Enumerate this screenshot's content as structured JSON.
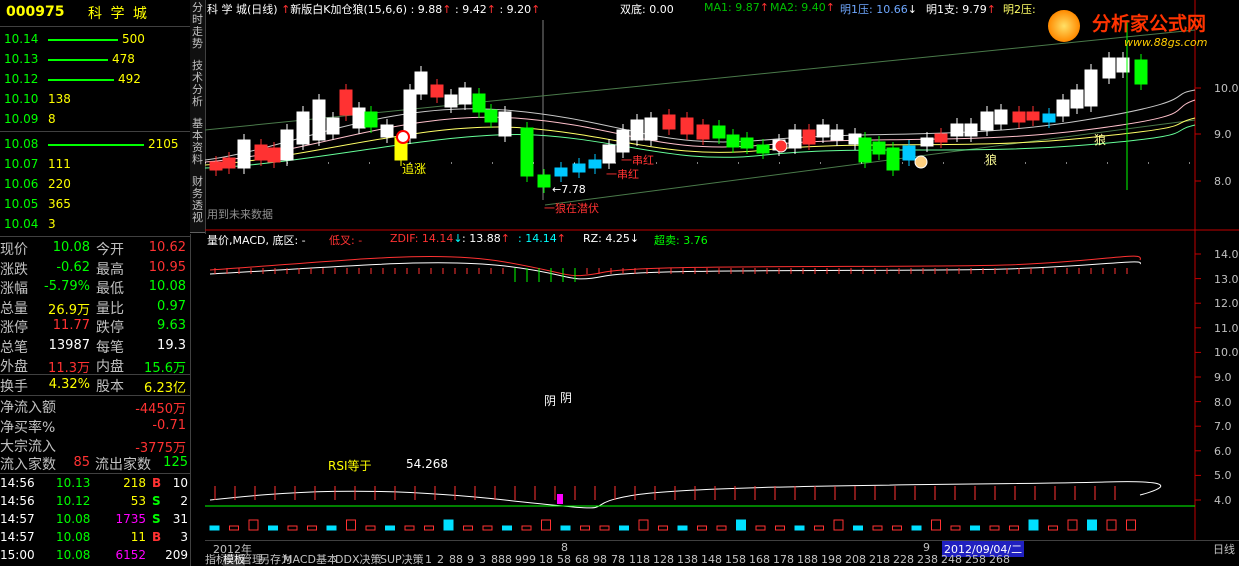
{
  "stock": {
    "code": "000975",
    "name": "科 学 城"
  },
  "asks": [
    {
      "price": "10.14",
      "vol": "500",
      "bar": 70
    },
    {
      "price": "10.13",
      "vol": "478",
      "bar": 60
    },
    {
      "price": "10.12",
      "vol": "492",
      "bar": 66
    },
    {
      "price": "10.10",
      "vol": "138",
      "bar": 0
    },
    {
      "price": "10.09",
      "vol": "8",
      "bar": 0
    }
  ],
  "bids": [
    {
      "price": "10.08",
      "vol": "2105",
      "bar": 96
    },
    {
      "price": "10.07",
      "vol": "111",
      "bar": 0
    },
    {
      "price": "10.06",
      "vol": "220",
      "bar": 0
    },
    {
      "price": "10.05",
      "vol": "365",
      "bar": 0
    },
    {
      "price": "10.04",
      "vol": "3",
      "bar": 0
    }
  ],
  "stats": [
    {
      "k1": "现价",
      "v1": "10.08",
      "c1": "grn",
      "k2": "今开",
      "v2": "10.62",
      "c2": "red"
    },
    {
      "k1": "涨跌",
      "v1": "-0.62",
      "c1": "grn",
      "k2": "最高",
      "v2": "10.95",
      "c2": "red"
    },
    {
      "k1": "涨幅",
      "v1": "-5.79%",
      "c1": "grn",
      "k2": "最低",
      "v2": "10.08",
      "c2": "grn"
    },
    {
      "k1": "总量",
      "v1": "26.9万",
      "c1": "yel",
      "k2": "量比",
      "v2": "0.97",
      "c2": "grn"
    },
    {
      "k1": "涨停",
      "v1": "11.77",
      "c1": "red",
      "k2": "跌停",
      "v2": "9.63",
      "c2": "grn"
    },
    {
      "k1": "总笔",
      "v1": "13987",
      "c1": "wht",
      "k2": "每笔",
      "v2": "19.3",
      "c2": "wht"
    },
    {
      "k1": "外盘",
      "v1": "11.3万",
      "c1": "red",
      "k2": "内盘",
      "v2": "15.6万",
      "c2": "grn"
    }
  ],
  "turnover": {
    "k1": "换手",
    "v1": "4.32%",
    "k2": "股本",
    "v2": "6.23亿"
  },
  "flows": [
    {
      "k": "净流入额",
      "v": "-4450万"
    },
    {
      "k": "净买率%",
      "v": "-0.71"
    },
    {
      "k": "大宗流入",
      "v": "-3775万"
    }
  ],
  "flowcount": {
    "k1": "流入家数",
    "v1": "85",
    "k2": "流出家数",
    "v2": "125"
  },
  "ticks": [
    {
      "t": "14:56",
      "p": "10.13",
      "pc": "grn",
      "v": "218",
      "vc": "yel",
      "s": "B",
      "sc": "red",
      "n": "10"
    },
    {
      "t": "14:56",
      "p": "10.12",
      "pc": "grn",
      "v": "53",
      "vc": "yel",
      "s": "S",
      "sc": "grn",
      "n": "2"
    },
    {
      "t": "14:57",
      "p": "10.08",
      "pc": "grn",
      "v": "1735",
      "vc": "mag",
      "s": "S",
      "sc": "grn",
      "n": "31"
    },
    {
      "t": "14:57",
      "p": "10.08",
      "pc": "grn",
      "v": "11",
      "vc": "yel",
      "s": "B",
      "sc": "red",
      "n": "3"
    },
    {
      "t": "15:00",
      "p": "10.08",
      "pc": "grn",
      "v": "6152",
      "vc": "mag",
      "s": "",
      "sc": "grn",
      "n": "209"
    }
  ],
  "vtabs": [
    "分时走势",
    "技术分析",
    "基本资料",
    "财务透视"
  ],
  "main_header": {
    "title": "科 学 城(日线)",
    "indicator": "新版白K加仓狼(15,6,6)",
    "v1": ": 9.88",
    "v2": ": 9.42",
    "v3": ": 9.20",
    "double_bottom": "双底: 0.00",
    "ma1": "MA1: 9.87",
    "ma2": "MA2: 9.40",
    "r1": "明1压: 10.66",
    "s1": "明1支: 9.79",
    "r2": "明2压:"
  },
  "logo": {
    "text": "分析家公式网",
    "url": "www.88gs.com"
  },
  "price_axis": [
    "10.0",
    "9.0",
    "8.0"
  ],
  "annotations": {
    "chase": "追涨",
    "low_price": "7.78",
    "wolf_ambush": "狼在潜伏",
    "red_chain": "一串红",
    "red_chain2": "一串红",
    "wolf1": "狼",
    "wolf2": "狼",
    "future_data": "用到未来数据"
  },
  "sub_header": {
    "label": "量价,MACD,",
    "bottom": "底区: -",
    "low_cross": "低叉: -",
    "zdif": "ZDIF: 14.14",
    "v2": ": 13.88",
    "v3": ": 14.14",
    "rz": "RZ: 4.25",
    "overbought": "超卖: 3.76"
  },
  "sub_axis": [
    "14.0",
    "13.0",
    "12.0",
    "11.0",
    "10.0",
    "9.0",
    "8.0",
    "7.0",
    "6.0",
    "5.0",
    "4.0"
  ],
  "sub_labels": {
    "yin1": "阴",
    "yin2": "阴",
    "rsi": "RSI等于",
    "rsi_val": "54.268"
  },
  "x_axis": {
    "year": "2012年",
    "m8": "8",
    "m9": "9",
    "date": "2012/09/04/二",
    "period": "日线"
  },
  "bottom_tabs": [
    "指标",
    "模板",
    "管理",
    "另存为",
    "MACD基本",
    "DDX决策",
    "SUP决策",
    "1",
    "2",
    "88",
    "9",
    "3",
    "888",
    "999",
    "18",
    "58",
    "68",
    "98",
    "78",
    "118",
    "128",
    "138",
    "148",
    "158",
    "168",
    "178",
    "188",
    "198",
    "208",
    "218",
    "228",
    "238",
    "248",
    "258",
    "268"
  ],
  "colors": {
    "up": "#ff3232",
    "down": "#00ff00",
    "bg": "#000000",
    "axis": "#c0c0c0"
  }
}
